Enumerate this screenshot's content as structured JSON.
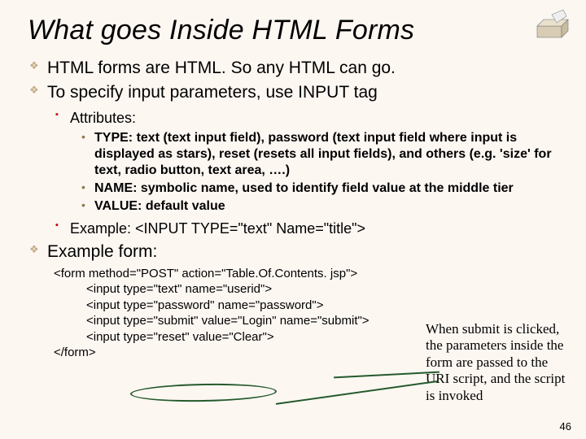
{
  "title": "What goes Inside HTML Forms",
  "bullets": {
    "b1": "HTML forms are HTML.  So any HTML can go.",
    "b2": "To specify input parameters, use INPUT tag",
    "b2_sub_attr": "Attributes:",
    "attr_type": "TYPE: text (text input field), password (text input field where input is displayed as stars), reset (resets all input fields), and others (e.g. 'size' for text, radio button, text area, ….)",
    "attr_name": "NAME: symbolic name, used to identify field value at the middle tier",
    "attr_value": "VALUE: default value",
    "b2_sub_example": "Example: <INPUT TYPE=\"text\" Name=\"title\">",
    "b3": "Example form:"
  },
  "code": {
    "l1": "<form method=\"POST\" action=\"Table.Of.Contents. jsp\">",
    "l2": "<input type=\"text\" name=\"userid\">",
    "l3": "<input type=\"password\" name=\"password\">",
    "l4": "<input type=\"submit\" value=\"Login\" name=\"submit\">",
    "l5": "<input type=\"reset\" value=\"Clear\">",
    "l6": "</form>"
  },
  "side_note": "When submit is clicked, the parameters inside the form are passed to the URI script, and the script is invoked",
  "page_number": "46"
}
